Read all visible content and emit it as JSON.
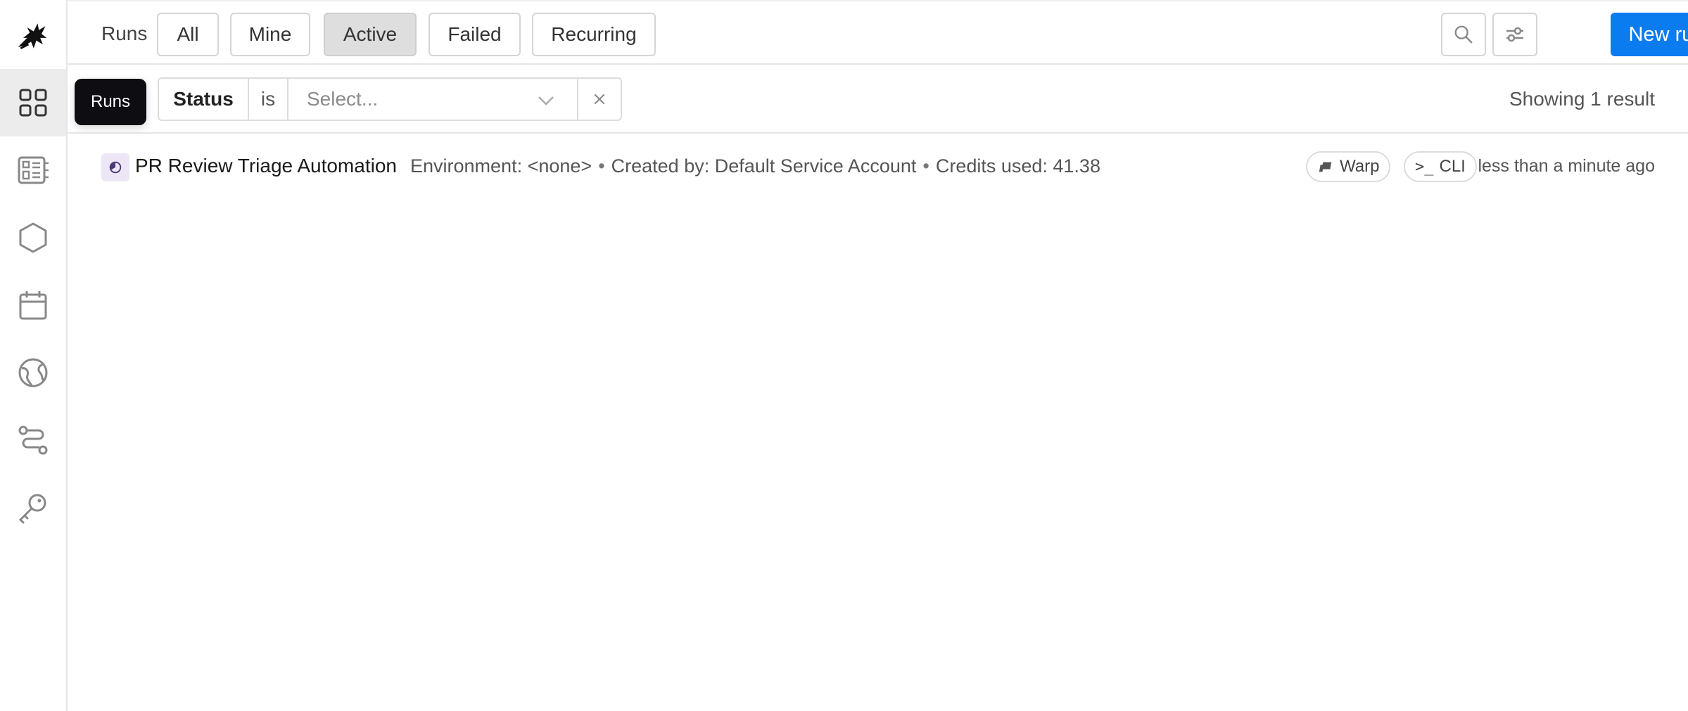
{
  "sidebar": {
    "logo": "dragon-logo",
    "items": [
      {
        "icon": "grid-icon",
        "active": true
      },
      {
        "icon": "dashboard-icon",
        "active": false
      },
      {
        "icon": "hexagon-icon",
        "active": false
      },
      {
        "icon": "calendar-icon",
        "active": false
      },
      {
        "icon": "globe-icon",
        "active": false
      },
      {
        "icon": "route-icon",
        "active": false
      },
      {
        "icon": "key-icon",
        "active": false
      }
    ]
  },
  "header": {
    "title": "Runs",
    "tabs": [
      {
        "label": "All"
      },
      {
        "label": "Mine"
      },
      {
        "label": "Active",
        "selected": true
      },
      {
        "label": "Failed"
      },
      {
        "label": "Recurring"
      }
    ],
    "new_run_label": "New run"
  },
  "filter": {
    "tooltip": "Runs",
    "field": "Status",
    "operator": "is",
    "placeholder": "Select...",
    "result_count": "Showing 1 result"
  },
  "runs": [
    {
      "title": "PR Review Triage Automation",
      "environment": "Environment: <none>",
      "created_by": "Created by: Default Service Account",
      "credits": "Credits used: 41.38",
      "tags": [
        "Warp",
        "CLI"
      ],
      "time": "less than a minute ago"
    }
  ],
  "colors": {
    "primary": "#0a7cf0",
    "active_nav": "#ececec",
    "selected_tab": "#dedede",
    "status_bg": "#ece6f7"
  }
}
